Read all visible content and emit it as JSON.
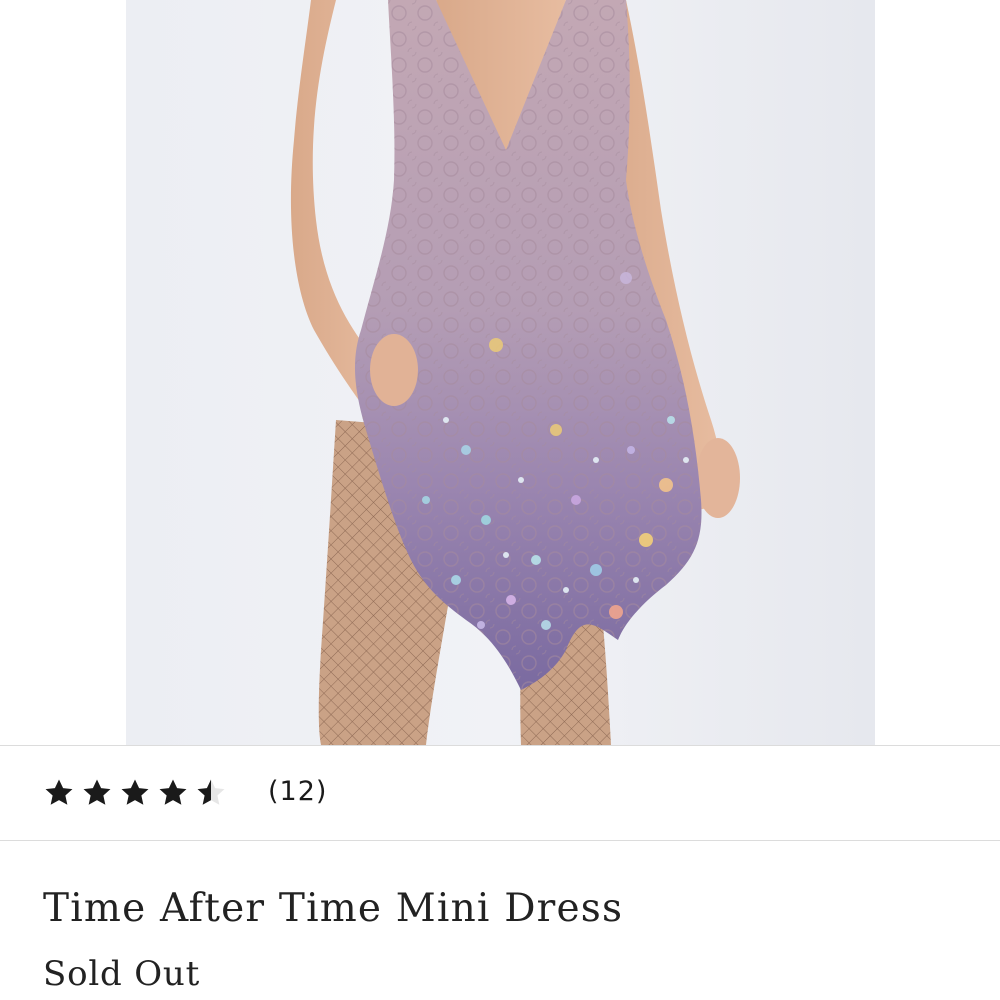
{
  "product": {
    "image": {
      "icon": "product-photo-dress"
    },
    "rating": {
      "value": 4.5,
      "max": 5,
      "count_label": "(12)"
    },
    "title": "Time After Time Mini Dress",
    "availability": "Sold Out"
  },
  "colors": {
    "background": "#ffffff",
    "divider": "#dcdcdc",
    "text": "#222222",
    "star": "#1a1a1a",
    "dress_lavender": "#b7a0b8",
    "dress_purple": "#7d6a9f"
  }
}
